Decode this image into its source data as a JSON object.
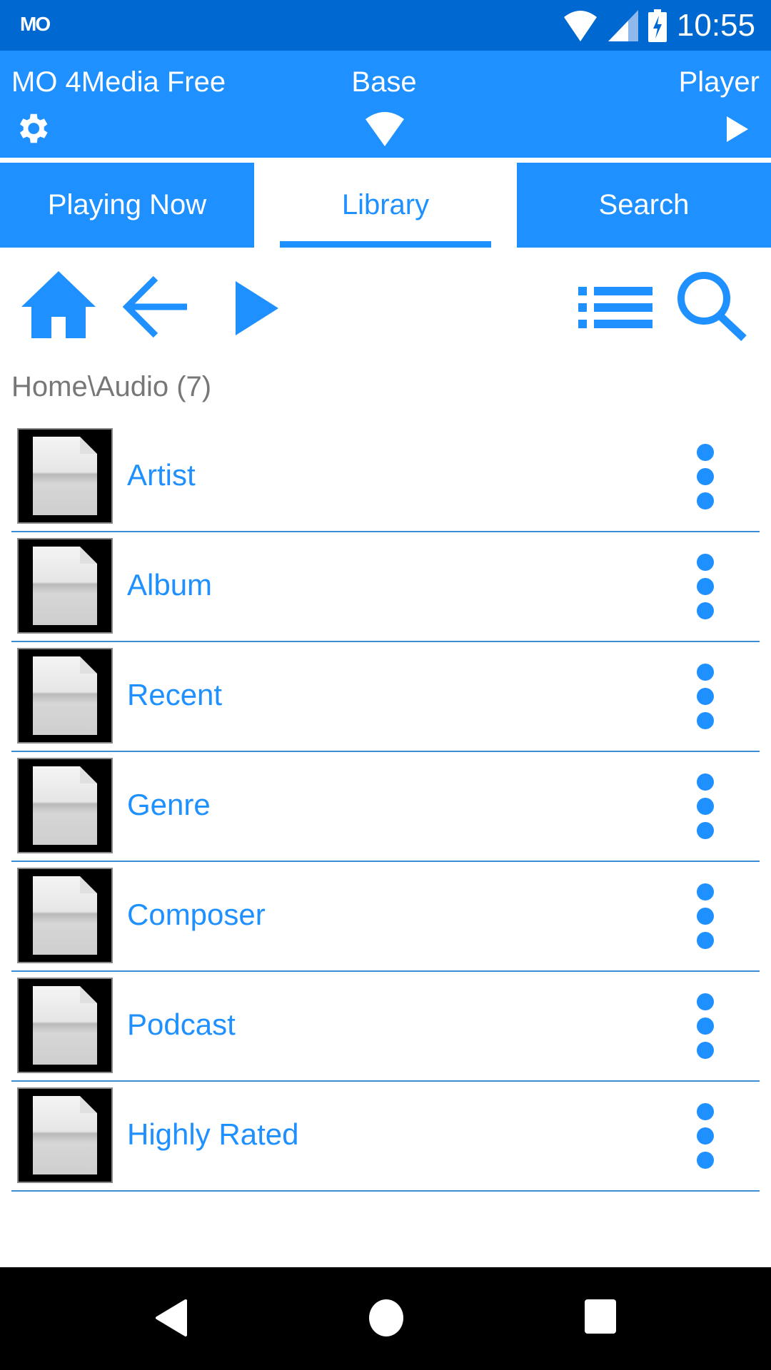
{
  "status_bar": {
    "app_icon": "MO",
    "time": "10:55",
    "icons": [
      "wifi-icon",
      "cell-signal-icon",
      "battery-charging-icon"
    ]
  },
  "header": {
    "title": "MO 4Media Free",
    "center_label": "Base",
    "right_label": "Player",
    "icons": [
      "gear-icon",
      "wifi-icon",
      "play-icon"
    ]
  },
  "tabs": [
    {
      "label": "Playing Now",
      "active": false
    },
    {
      "label": "Library",
      "active": true
    },
    {
      "label": "Search",
      "active": false
    }
  ],
  "toolbar": {
    "icons": [
      "home-icon",
      "back-arrow-icon",
      "play-icon",
      "list-view-icon",
      "search-icon"
    ]
  },
  "breadcrumb": "Home\\Audio (7)",
  "list": {
    "items": [
      {
        "label": "Artist"
      },
      {
        "label": "Album"
      },
      {
        "label": "Recent"
      },
      {
        "label": "Genre"
      },
      {
        "label": "Composer"
      },
      {
        "label": "Podcast"
      },
      {
        "label": "Highly Rated"
      }
    ]
  },
  "colors": {
    "status_bar": "#0068d1",
    "accent": "#1e90ff",
    "breadcrumb_text": "#777777",
    "nav_bar": "#000000"
  },
  "nav_bar": {
    "buttons": [
      "back-icon",
      "home-icon",
      "recents-icon"
    ]
  }
}
